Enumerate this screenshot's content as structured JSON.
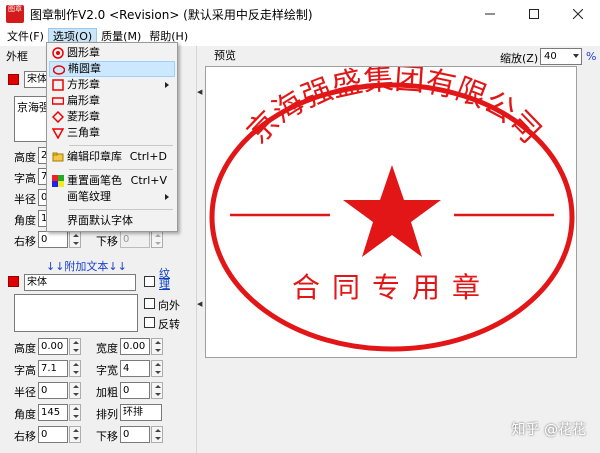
{
  "window": {
    "title": "图章制作V2.0 <Revision> (默认采用中反走样绘制)",
    "icon_text": "图章",
    "controls": [
      "minimize-icon",
      "maximize-icon",
      "close-icon"
    ]
  },
  "menubar": [
    {
      "label": "文件(F)"
    },
    {
      "label": "选项(O)",
      "open": true
    },
    {
      "label": "质量(M)"
    },
    {
      "label": "帮助(H)"
    }
  ],
  "dropdown": {
    "items": [
      {
        "label": "圆形章",
        "icon": "circle-seal-icon"
      },
      {
        "label": "椭圆章",
        "icon": "ellipse-seal-icon",
        "highlighted": true
      },
      {
        "label": "方形章",
        "icon": "square-seal-icon",
        "submenu": true
      },
      {
        "label": "扁形章",
        "icon": "flat-seal-icon"
      },
      {
        "label": "菱形章",
        "icon": "diamond-seal-icon"
      },
      {
        "label": "三角章",
        "icon": "triangle-seal-icon"
      },
      {
        "label": "编辑印章库",
        "icon": "edit-library-icon",
        "shortcut": "Ctrl+D"
      },
      {
        "label": "重置画笔色",
        "icon": "reset-color-icon",
        "shortcut": "Ctrl+V"
      },
      {
        "label": "画笔纹理",
        "submenu": true
      },
      {
        "label": "界面默认字体"
      }
    ]
  },
  "left_panel": {
    "frame_label": "外框",
    "main_font": "宋体",
    "main_text": "京海强",
    "fields": {
      "height_label": "高度",
      "height_value": "2",
      "charheight_label": "字高",
      "charheight_value": "7",
      "radius_label": "半径",
      "radius_value": "0",
      "angle_label": "角度",
      "angle_value": "1",
      "right_shift_label": "右移",
      "right_shift_value": "0",
      "down_shift_label": "下移",
      "down_shift_value": "0"
    },
    "extra": {
      "title": "↓↓附加文本↓↓",
      "font": "宋体",
      "texture_label": "纹理",
      "outward_label": "向外",
      "invert_label": "反转",
      "height_label": "高度",
      "height_value": "0.00",
      "width_label": "宽度",
      "width_value": "0.00",
      "charheight_label": "字高",
      "charheight_value": "7.1",
      "charwidth_label": "字宽",
      "charwidth_value": "4",
      "radius_label": "半径",
      "radius_value": "0",
      "bold_label": "加粗",
      "bold_value": "0",
      "angle_label": "角度",
      "angle_value": "145",
      "arrange_label": "排列",
      "arrange_value": "环排",
      "right_shift_label": "右移",
      "right_shift_value": "0",
      "down_shift_label": "下移",
      "down_shift_value": "0"
    }
  },
  "preview": {
    "label": "预览",
    "zoom_label": "缩放(Z)",
    "zoom_value": "40",
    "zoom_unit": "%",
    "seal": {
      "top_text": "京海强盛集团有限公司",
      "bottom_text": "合同专用章",
      "color": "#e21616"
    }
  },
  "watermark": "知乎 @花花"
}
